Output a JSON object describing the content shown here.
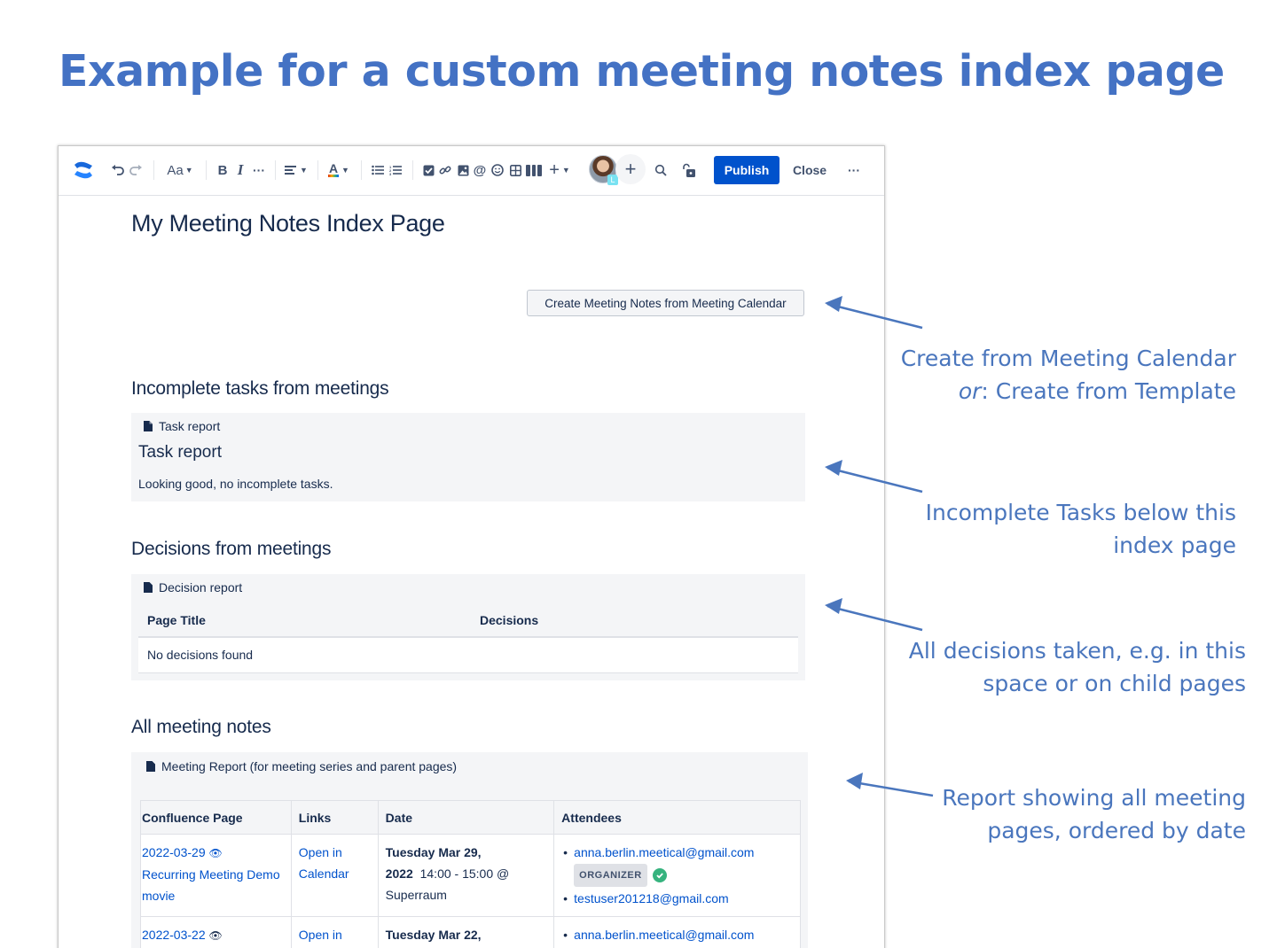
{
  "slide": {
    "title": "Example for a custom meeting notes index page"
  },
  "toolbar": {
    "text_style": "Aa",
    "publish_label": "Publish",
    "close_label": "Close",
    "more_label": "···"
  },
  "page": {
    "title": "My Meeting Notes Index Page",
    "create_button_label": "Create Meeting Notes from Meeting Calendar"
  },
  "tasks": {
    "heading": "Incomplete tasks from meetings",
    "macro_label": "Task report",
    "report_title": "Task report",
    "status": "Looking good, no incomplete tasks."
  },
  "decisions": {
    "heading": "Decisions from meetings",
    "macro_label": "Decision report",
    "columns": [
      "Page Title",
      "Decisions"
    ],
    "empty": "No decisions found"
  },
  "meetings": {
    "heading": "All meeting notes",
    "macro_label": "Meeting Report (for meeting series and parent pages)",
    "columns": [
      "Confluence Page",
      "Links",
      "Date",
      "Attendees"
    ],
    "rows": [
      {
        "page_date": "2022-03-29",
        "page_title": "Recurring Meeting Demo movie",
        "link_1": "Open in",
        "link_2": "Calendar",
        "date_bold_1": "Tuesday Mar 29,",
        "date_bold_2": "2022",
        "time": "14:00 - 15:00 @",
        "location": "Superraum",
        "attendee_1": "anna.berlin.meetical@gmail.com",
        "organizer_badge": "ORGANIZER",
        "attendee_2": "testuser201218@gmail.com"
      },
      {
        "page_date": "2022-03-22",
        "link_1": "Open in",
        "date_bold_1": "Tuesday Mar 22,",
        "attendee_1": "anna.berlin.meetical@gmail.com"
      }
    ]
  },
  "annotations": [
    {
      "line1": "Create from Meeting Calendar",
      "line2_em": "or",
      "line2": ": Create from Template"
    },
    {
      "line1": "Incomplete Tasks below this",
      "line2": "index page"
    },
    {
      "line1": "All decisions taken, e.g. in this",
      "line2": "space or on child pages"
    },
    {
      "line1": "Report showing all meeting",
      "line2": "pages, ordered by date"
    }
  ],
  "colors": {
    "slide_title": "#4472c4",
    "annotation": "#4a76bd",
    "primary_button": "#0052cc",
    "link": "#0052cc",
    "macro_bg": "#f4f5f7",
    "organizer_check": "#36b37e"
  }
}
